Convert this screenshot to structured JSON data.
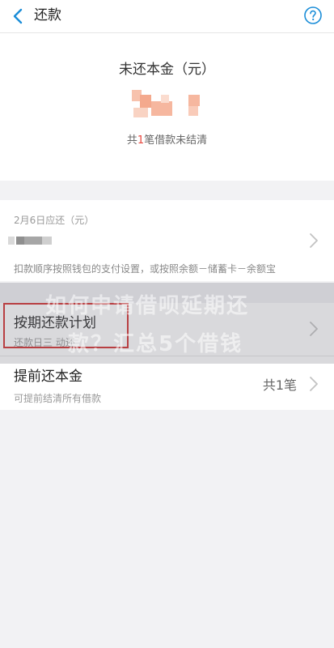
{
  "navbar": {
    "title": "还款",
    "back_icon": "chevron-left-icon",
    "help_icon": "question-circle-icon",
    "accent_color": "#1a8dd8"
  },
  "summary": {
    "label": "未还本金（元）",
    "count_prefix": "共",
    "count_number": "1",
    "count_suffix": "笔借款未结清",
    "count_color": "#e8463d"
  },
  "due": {
    "date_label": "2月6日应还（元）",
    "note": "扣款顺序按照钱包的支付设置，或按照余额－储蓄卡－余额宝"
  },
  "plan_row": {
    "title": "按期还款计划",
    "subtitle": "还款日三 动还",
    "chevron_icon": "chevron-right-icon"
  },
  "prepay_row": {
    "title": "提前还本金",
    "subtitle": "可提前结清所有借款",
    "value": "共1笔",
    "chevron_icon": "chevron-right-icon"
  },
  "watermark": {
    "line1": "如何申请借呗延期还",
    "line2": "款？汇总5个借钱"
  }
}
